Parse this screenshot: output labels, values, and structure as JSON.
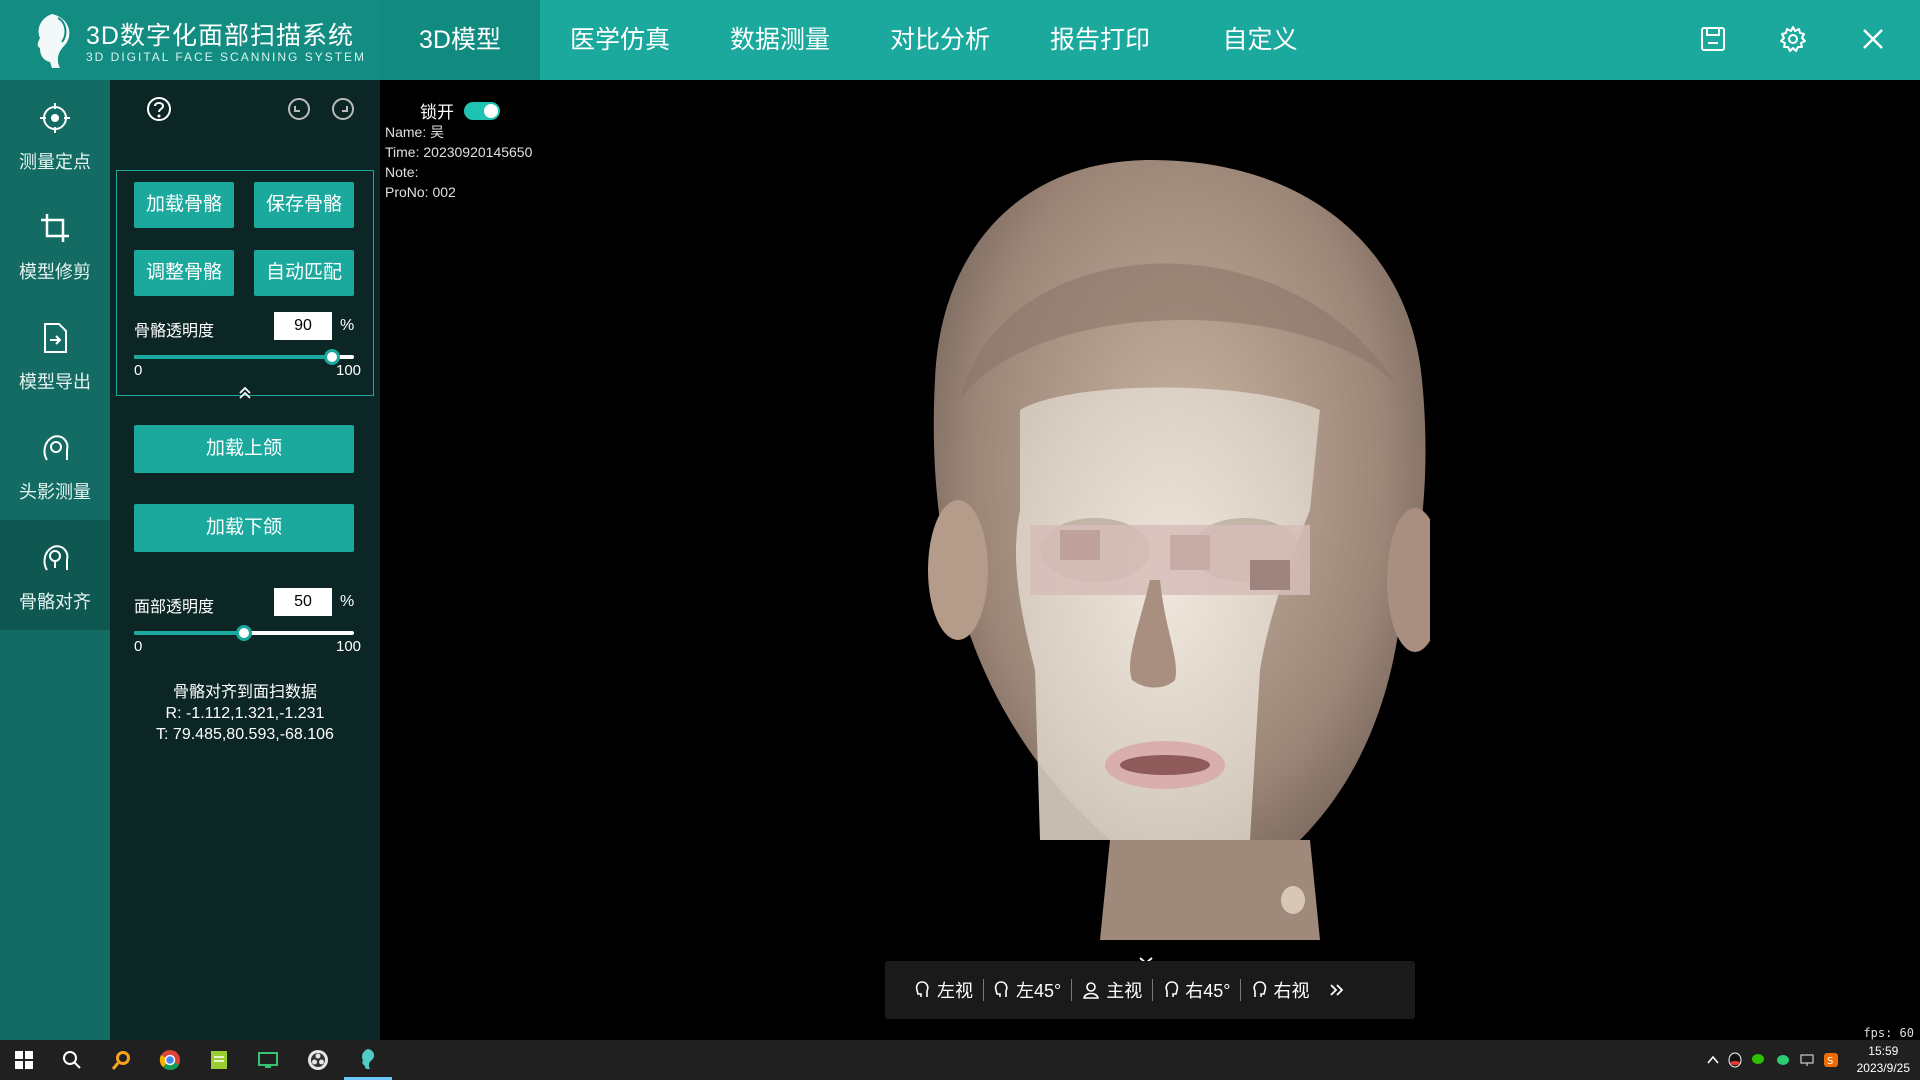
{
  "brand": {
    "title_cn": "3D数字化面部扫描系统",
    "title_en": "3D DIGITAL FACE SCANNING SYSTEM"
  },
  "nav": [
    {
      "label": "3D模型",
      "active": true
    },
    {
      "label": "医学仿真",
      "active": false
    },
    {
      "label": "数据测量",
      "active": false
    },
    {
      "label": "对比分析",
      "active": false
    },
    {
      "label": "报告打印",
      "active": false
    },
    {
      "label": "自定义",
      "active": false
    }
  ],
  "top_actions": [
    "save-icon",
    "gear-icon",
    "close-icon"
  ],
  "rail": [
    {
      "label": "测量定点",
      "icon": "target-icon"
    },
    {
      "label": "模型修剪",
      "icon": "crop-icon"
    },
    {
      "label": "模型导出",
      "icon": "export-icon"
    },
    {
      "label": "头影测量",
      "icon": "head-measure-icon"
    },
    {
      "label": "骨骼对齐",
      "icon": "bone-align-icon",
      "active": true
    }
  ],
  "panel": {
    "buttons": {
      "load_bone": "加载骨骼",
      "save_bone": "保存骨骼",
      "adjust_bone": "调整骨骼",
      "auto_match": "自动匹配",
      "load_upper": "加载上颌",
      "load_lower": "加载下颌"
    },
    "bone_opacity": {
      "label": "骨骼透明度",
      "value": "90",
      "unit": "%",
      "min": "0",
      "max": "100",
      "level": 0.9
    },
    "face_opacity": {
      "label": "面部透明度",
      "value": "50",
      "unit": "%",
      "min": "0",
      "max": "100",
      "level": 0.5
    },
    "info": {
      "title": "骨骼对齐到面扫数据",
      "r": "R: -1.112,1.321,-1.231",
      "t": "T: 79.485,80.593,-68.106"
    }
  },
  "viewport": {
    "lock_label": "锁开",
    "meta": {
      "name": "Name: 吴",
      "time": "Time: 20230920145650",
      "note": "Note:",
      "prono": "ProNo: 002"
    },
    "views": [
      "左视",
      "左45°",
      "主视",
      "右45°",
      "右视"
    ],
    "fps": "fps: 60"
  },
  "taskbar": {
    "time": "15:59",
    "date": "2023/9/25"
  },
  "colors": {
    "accent": "#1aa99c",
    "rail": "#136b63",
    "panel": "#0b2624"
  }
}
